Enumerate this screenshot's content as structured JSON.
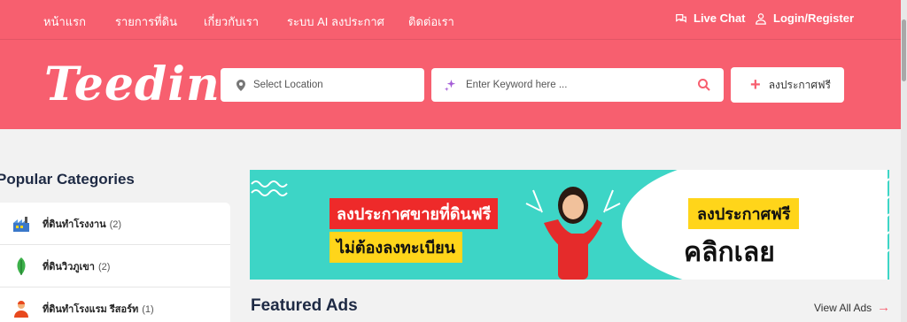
{
  "nav": {
    "links": [
      "หน้าแรก",
      "รายการที่ดิน",
      "เกี่ยวกับเรา",
      "ระบบ AI ลงประกาศ",
      "ติดต่อเรา"
    ],
    "live_chat": "Live Chat",
    "login": "Login/Register"
  },
  "header": {
    "logo": "Teedin",
    "location_placeholder": "Select Location",
    "keyword_placeholder": "Enter Keyword here ...",
    "post_free_label": "ลงประกาศฟรี"
  },
  "categories": {
    "title": "Popular Categories",
    "items": [
      {
        "label": "ที่ดินทำโรงงาน",
        "count": "(2)",
        "icon": "factory-icon"
      },
      {
        "label": "ที่ดินวิวภูเขา",
        "count": "(2)",
        "icon": "leaf-icon"
      },
      {
        "label": "ที่ดินทำโรงแรม รีสอร์ท",
        "count": "(1)",
        "icon": "receptionist-icon"
      }
    ]
  },
  "banner": {
    "line1": "ลงประกาศขายที่ดินฟรี",
    "line2": "ไม่ต้องลงทะเบียน",
    "cta_top": "ลงประกาศฟรี",
    "cta_bottom": "คลิกเลย"
  },
  "featured": {
    "title": "Featured Ads",
    "view_all": "View All Ads"
  },
  "colors": {
    "brand": "#f75f6f",
    "banner_bg": "#3dd5c6",
    "banner_red": "#ee2a2a",
    "banner_yellow": "#ffd51a"
  }
}
